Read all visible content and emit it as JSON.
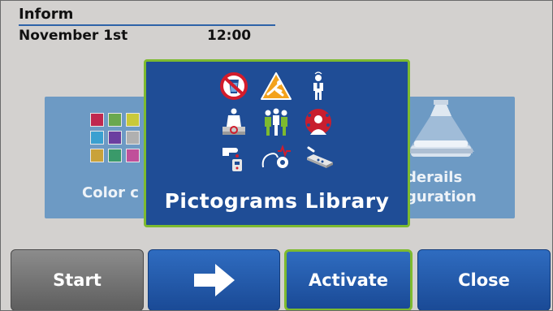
{
  "header": {
    "title": "Inform",
    "date": "November 1st",
    "time": "12:00"
  },
  "tiles": {
    "left": {
      "label": "Color c",
      "swatch_colors": [
        "#c0284f",
        "#6aa84f",
        "#c9c93a",
        "#9e9e9e",
        "#3aa0d0",
        "#6b3fa0",
        "#b0b0b0",
        "#a0a0a0",
        "#c9a23a",
        "#3a9a6a",
        "#c0509a",
        "#909090"
      ]
    },
    "right": {
      "label_line1": "derails",
      "label_line2": "guration",
      "icon": "ceiling-lamp-over-bed-icon"
    }
  },
  "modal": {
    "title": "Pictograms Library",
    "pictograms": [
      "no-drinking-icon",
      "fall-hazard-icon",
      "person-dizzy-icon",
      "person-in-bed-icon",
      "group-of-people-icon",
      "person-with-bugs-icon",
      "finger-prick-icon",
      "heart-monitor-icon",
      "bed-control-icon"
    ]
  },
  "buttons": {
    "start": "Start",
    "next_icon": "arrow-right-icon",
    "activate": "Activate",
    "close": "Close"
  },
  "colors": {
    "accent_green": "#7dba2f",
    "modal_blue": "#1f4d96",
    "tile_blue": "#6d9ac4",
    "button_blue": "#2f6cc0",
    "button_gray": "#6e6e6e"
  }
}
